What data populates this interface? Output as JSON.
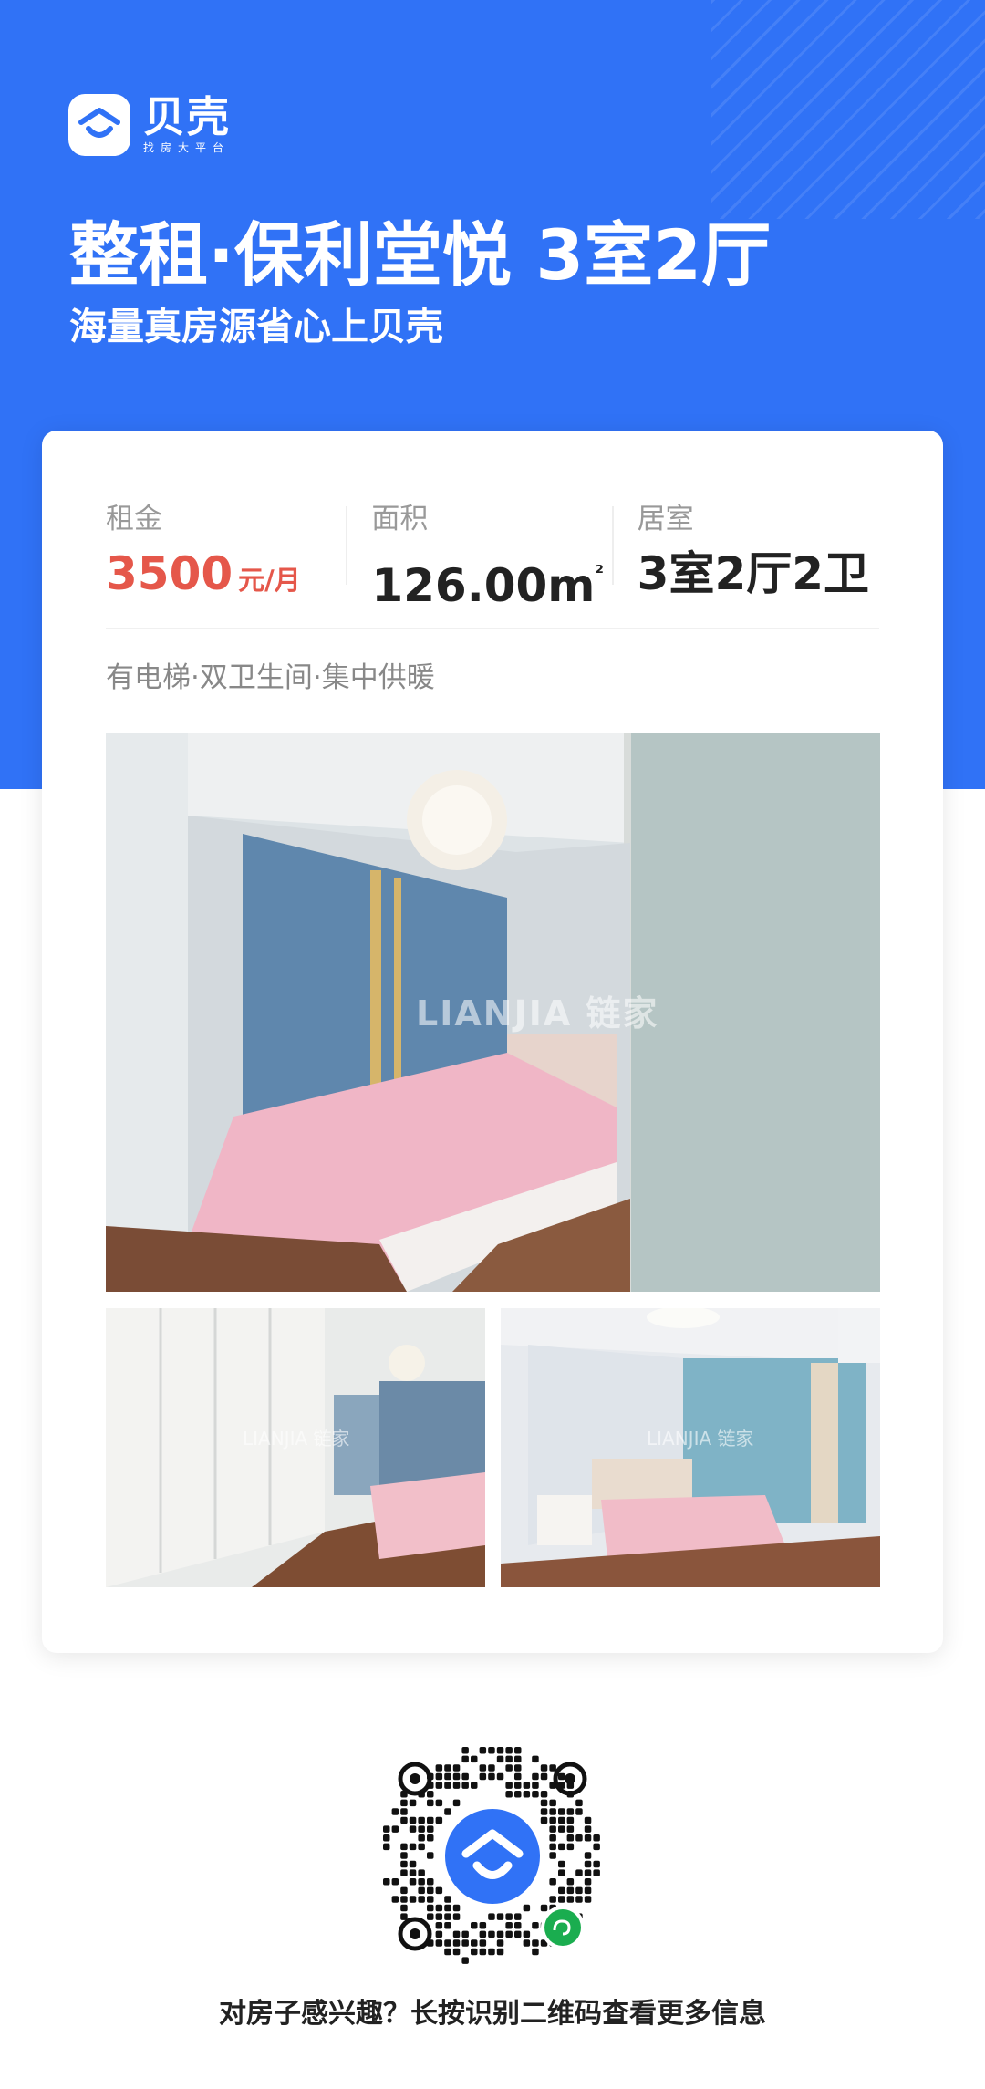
{
  "brand": {
    "name": "贝壳",
    "tagline": "找房大平台",
    "logo_icon": "house-roof-icon",
    "color": "#3072f6"
  },
  "header": {
    "title": "整租·保利堂悦 3室2厅",
    "subtitle": "海量真房源省心上贝壳"
  },
  "stats": [
    {
      "label": "租金",
      "value": "3500",
      "unit": "元/月"
    },
    {
      "label": "面积",
      "value": "126.00m",
      "unit_sup": "²"
    },
    {
      "label": "居室",
      "value": "3室2厅2卫"
    }
  ],
  "price_color": "#e5574a",
  "tags": "有电梯·双卫生间·集中供暖",
  "photos": {
    "watermark": "LIANJIA 链家"
  },
  "qr": {
    "center_icon": "beike-logo-icon",
    "badge_icon": "mini-program-icon"
  },
  "footer": {
    "text": "对房子感兴趣？长按识别二维码查看更多信息"
  }
}
